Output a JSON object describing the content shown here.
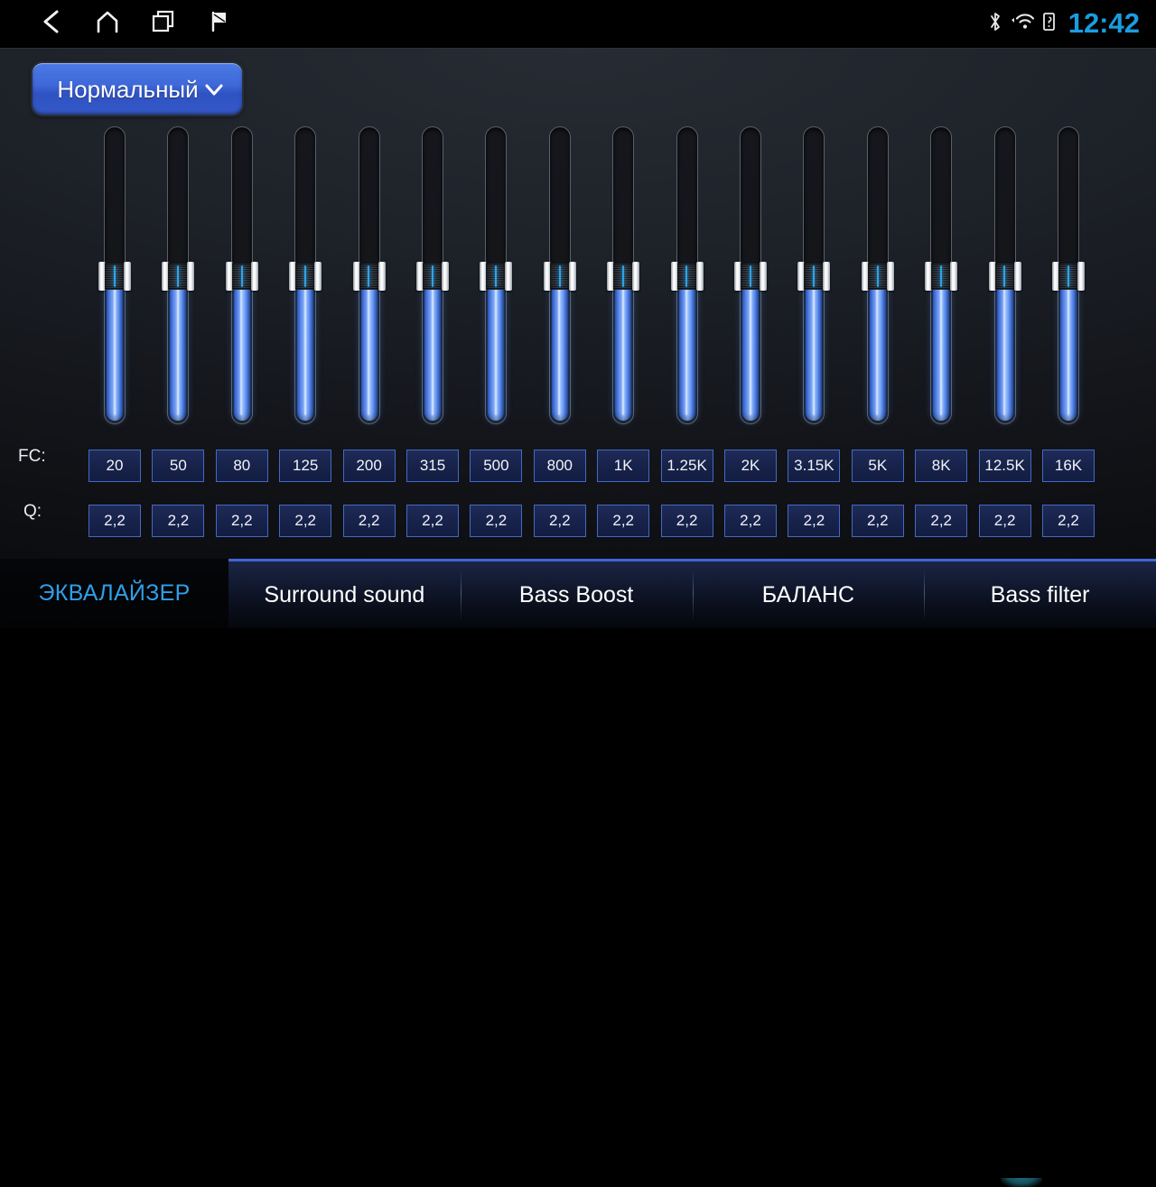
{
  "statusbar": {
    "nav": [
      {
        "name": "back-icon",
        "label": "Back"
      },
      {
        "name": "home-icon",
        "label": "Home"
      },
      {
        "name": "recents-icon",
        "label": "Recent apps"
      },
      {
        "name": "flag-icon",
        "label": "Flag"
      }
    ],
    "indicators": [
      {
        "name": "bluetooth-icon",
        "label": "Bluetooth"
      },
      {
        "name": "wifi-icon",
        "label": "Wi-Fi"
      },
      {
        "name": "sim-icon",
        "label": "SIM"
      }
    ],
    "time": "12:42",
    "time_color": "#1a9de0"
  },
  "preset": {
    "label": "Нормальный",
    "caret": "chevron-down-icon",
    "accent": "#3f68d8"
  },
  "equalizer": {
    "fc_label": "FC:",
    "q_label": "Q:",
    "band_count": 16,
    "slider_value_percent": 50,
    "bands": [
      {
        "fc": "20",
        "q": "2,2",
        "value": 50
      },
      {
        "fc": "50",
        "q": "2,2",
        "value": 50
      },
      {
        "fc": "80",
        "q": "2,2",
        "value": 50
      },
      {
        "fc": "125",
        "q": "2,2",
        "value": 50
      },
      {
        "fc": "200",
        "q": "2,2",
        "value": 50
      },
      {
        "fc": "315",
        "q": "2,2",
        "value": 50
      },
      {
        "fc": "500",
        "q": "2,2",
        "value": 50
      },
      {
        "fc": "800",
        "q": "2,2",
        "value": 50
      },
      {
        "fc": "1K",
        "q": "2,2",
        "value": 50
      },
      {
        "fc": "1.25K",
        "q": "2,2",
        "value": 50
      },
      {
        "fc": "2K",
        "q": "2,2",
        "value": 50
      },
      {
        "fc": "3.15K",
        "q": "2,2",
        "value": 50
      },
      {
        "fc": "5K",
        "q": "2,2",
        "value": 50
      },
      {
        "fc": "8K",
        "q": "2,2",
        "value": 50
      },
      {
        "fc": "12.5K",
        "q": "2,2",
        "value": 50
      },
      {
        "fc": "16K",
        "q": "2,2",
        "value": 50
      }
    ]
  },
  "tabs": {
    "active_index": 0,
    "items": [
      {
        "label": "ЭКВАЛАЙЗЕР",
        "active": true
      },
      {
        "label": "Surround sound",
        "active": false
      },
      {
        "label": "Bass Boost",
        "active": false
      },
      {
        "label": "БАЛАНС",
        "active": false
      },
      {
        "label": "Bass filter",
        "active": false
      }
    ],
    "active_color": "#2f9fe8",
    "inactive_color": "#ffffff"
  }
}
